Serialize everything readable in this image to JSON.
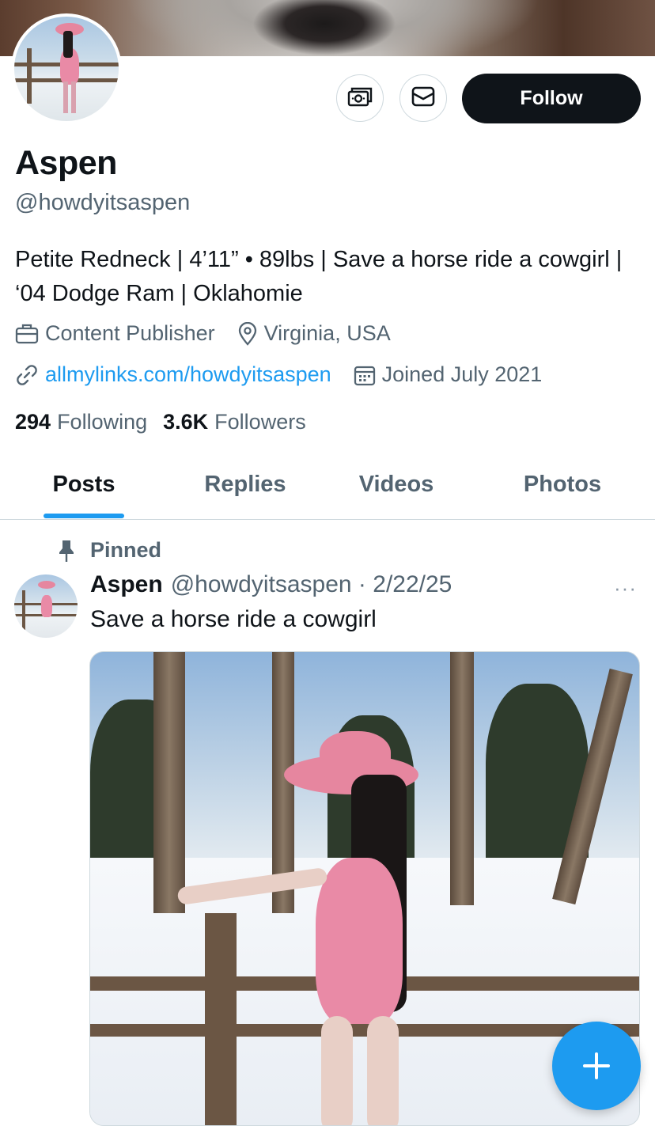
{
  "profile": {
    "name": "Aspen",
    "handle": "@howdyitsaspen",
    "bio": "Petite Redneck | 4’11” • 89lbs | Save a horse ride a cowgirl | ‘04 Dodge Ram | Oklahomie",
    "occupation": "Content Publisher",
    "location": "Virginia, USA",
    "website": "allmylinks.com/howdyitsaspen",
    "joined": "Joined July 2021",
    "following_count": "294",
    "following_label": "Following",
    "followers_count": "3.6K",
    "followers_label": "Followers"
  },
  "actions": {
    "follow_label": "Follow",
    "subscribe_icon": "money-icon",
    "message_icon": "mail-icon"
  },
  "tabs": [
    {
      "label": "Posts",
      "active": true
    },
    {
      "label": "Replies",
      "active": false
    },
    {
      "label": "Videos",
      "active": false
    },
    {
      "label": "Photos",
      "active": false
    }
  ],
  "post": {
    "pinned_label": "Pinned",
    "author_name": "Aspen",
    "author_handle_date": "@howdyitsaspen · 2/22/25",
    "text": "Save a horse ride a cowgirl",
    "more_label": "···"
  },
  "colors": {
    "accent": "#1d9bf0",
    "text_primary": "#0f1419",
    "text_secondary": "#536471",
    "border": "#cfd9de"
  }
}
